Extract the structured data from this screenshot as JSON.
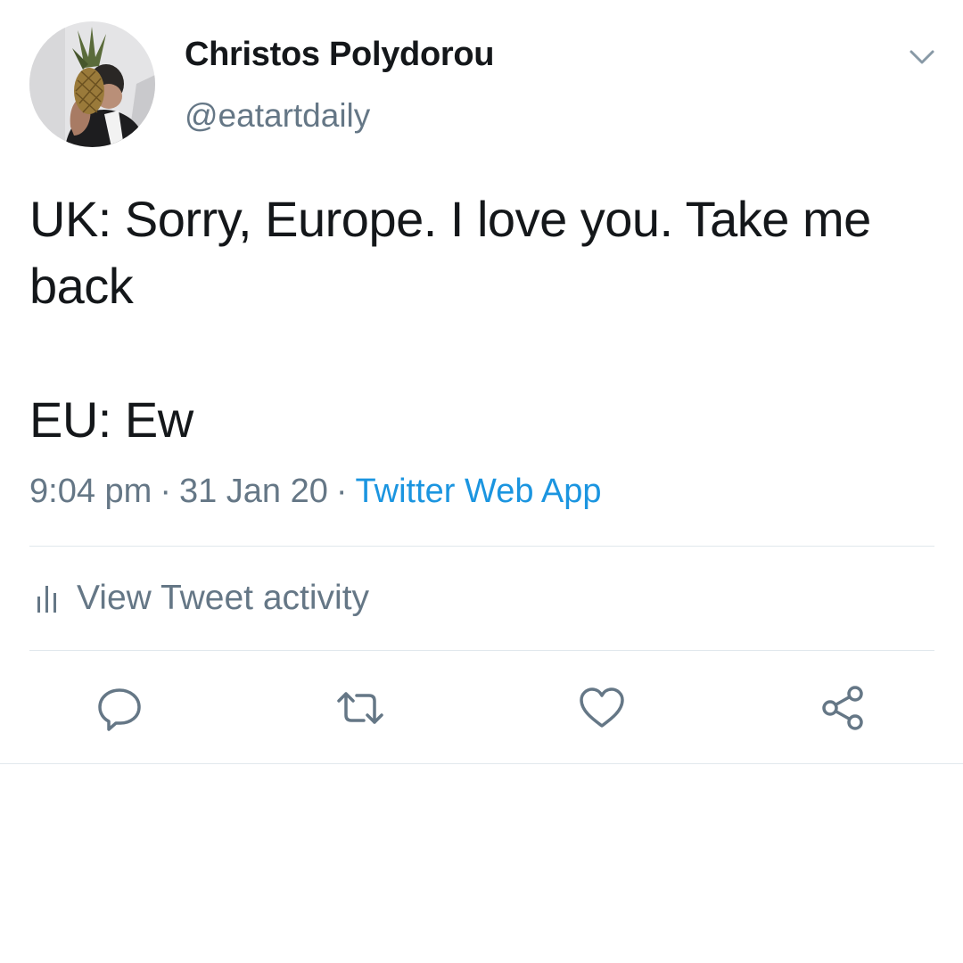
{
  "tweet": {
    "author": {
      "display_name": "Christos Polydorou",
      "handle": "@eatartdaily"
    },
    "text_line_1": "UK: Sorry, Europe. I love you. Take me back",
    "text_line_2": "EU: Ew",
    "time": "9:04 pm",
    "date": "31 Jan 20",
    "separator": "·",
    "source": "Twitter Web App"
  },
  "activity": {
    "label": "View Tweet activity"
  },
  "actions": [
    {
      "icon": "reply-icon"
    },
    {
      "icon": "retweet-icon"
    },
    {
      "icon": "like-icon"
    },
    {
      "icon": "share-icon"
    }
  ],
  "colors": {
    "text_primary": "#14171a",
    "text_secondary": "#657786",
    "link": "#1b95e0",
    "divider": "#e1e8ed"
  }
}
